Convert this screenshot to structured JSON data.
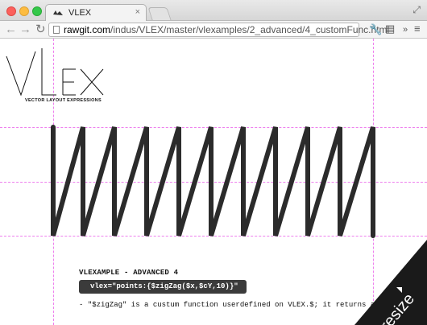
{
  "browser": {
    "tab_title": "VLEX",
    "tab_close": "×",
    "url_host": "rawgit.com",
    "url_path": "/indus/VLEX/master/vlexamples/2_advanced/4_customFunc.html",
    "icons": {
      "back": "back-arrow-icon",
      "forward": "forward-arrow-icon",
      "reload": "reload-icon",
      "wrench": "wrench-icon",
      "extension": "extension-icon",
      "more": "chevron-more-icon",
      "menu": "hamburger-menu-icon",
      "fullscreen": "fullscreen-icon"
    }
  },
  "logo": {
    "text": "VLEX",
    "subtitle": "VECTOR LAYOUT EXPRESSIONS"
  },
  "zigzag": {
    "teeth": 10,
    "stroke_color": "#2b2b2b",
    "guide_color": "#ee80ee"
  },
  "example": {
    "title": "VLEXAMPLE - ADVANCED 4",
    "code": "vlex=\"points:{$zigZag($x,$cY,10)}\"",
    "description": "- \"$zigZag\" is a custum function userdefined on VLEX.$; it returns a points string"
  },
  "resize_badge": {
    "label": "resize",
    "color": "#1a1a1a"
  }
}
